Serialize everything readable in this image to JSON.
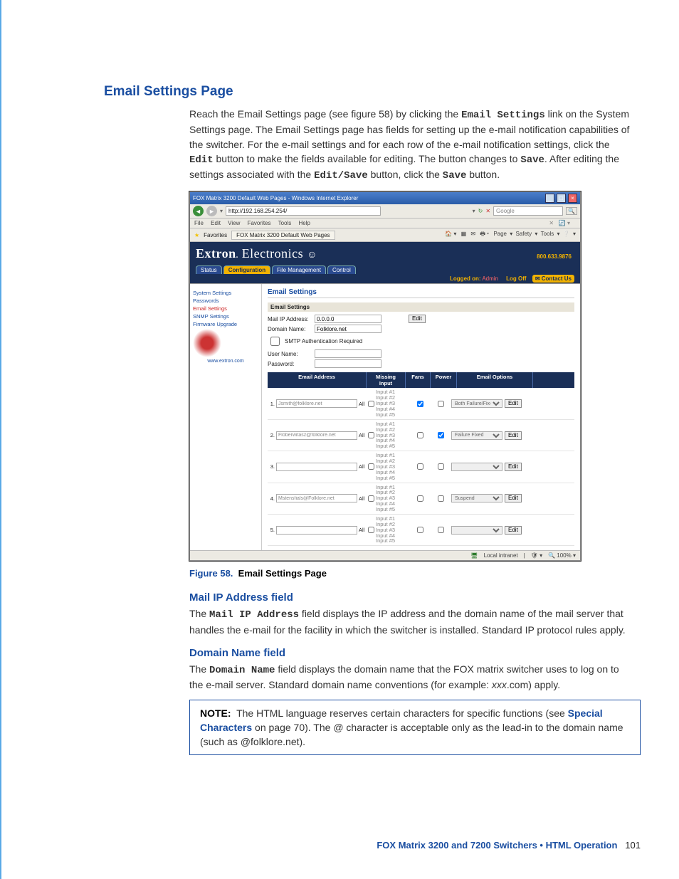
{
  "headings": {
    "page": "Email Settings Page",
    "mailip": "Mail IP Address field",
    "domain": "Domain Name field"
  },
  "intro": {
    "p1a": "Reach the Email Settings page (see figure 58) by clicking the ",
    "link": "Email Settings",
    "p1b": " link on the System Settings page. The Email Settings page has fields for setting up the e-mail notification capabilities of the switcher. For the e-mail settings and for each row of the e-mail notification settings, click the ",
    "editbtn": "Edit",
    "p1c": " button to make the fields available for editing. The button changes to ",
    "savebtn": "Save",
    "p1d": ". After editing the settings associated with the ",
    "editsave": "Edit/Save",
    "p1e": " button, click the ",
    "savebtn2": "Save",
    "p1f": " button."
  },
  "browser": {
    "title": "FOX Matrix 3200 Default Web Pages - Windows Internet Explorer",
    "url": "http://192.168.254.254/",
    "search_placeholder": "Google",
    "menu": {
      "file": "File",
      "edit": "Edit",
      "view": "View",
      "fav": "Favorites",
      "tools": "Tools",
      "help": "Help"
    },
    "fav_label": "Favorites",
    "tab": "FOX Matrix 3200 Default Web Pages",
    "toolbar": {
      "page": "Page",
      "safety": "Safety",
      "tools": "Tools"
    },
    "status": {
      "zone": "Local intranet",
      "zoom": "100%"
    }
  },
  "extron": {
    "brand": "Extron Electronics",
    "tabs": {
      "status": "Status",
      "config": "Configuration",
      "file": "File Management",
      "control": "Control"
    },
    "phone": "800.633.9876",
    "logged": "Logged on:",
    "admin": "Admin",
    "logoff": "Log Off",
    "contact": "Contact Us",
    "sidebar": {
      "sys": "System Settings",
      "pw": "Passwords",
      "email": "Email Settings",
      "snmp": "SNMP Settings",
      "fw": "Firmware Upgrade",
      "url": "www.extron.com"
    },
    "pagetitle": "Email Settings",
    "panel": "Email Settings",
    "fields": {
      "mailip_label": "Mail IP Address:",
      "mailip_val": "0.0.0.0",
      "domain_label": "Domain Name:",
      "domain_val": "Folklore.net",
      "smtp": "SMTP Authentication Required",
      "user_label": "User Name:",
      "pass_label": "Password:",
      "edit": "Edit"
    },
    "thead": {
      "email": "Email Address",
      "missing": "Missing Input",
      "fans": "Fans",
      "power": "Power",
      "opts": "Email Options"
    },
    "inputs": {
      "i1": "Input #1",
      "i2": "Input #2",
      "i3": "Input #3",
      "i4": "Input #4",
      "i5": "Input #5"
    },
    "all": "All",
    "rows": [
      {
        "n": "1.",
        "addr": "Jsmith@folklore.net",
        "fans": true,
        "power": false,
        "opt": "Both Failure/Fixed"
      },
      {
        "n": "2.",
        "addr": "Floberwitasz@folklore.net",
        "fans": false,
        "power": true,
        "opt": "Failure Fixed"
      },
      {
        "n": "3.",
        "addr": "",
        "fans": false,
        "power": false,
        "opt": ""
      },
      {
        "n": "4.",
        "addr": "Mstensfials@Folklore.net",
        "fans": false,
        "power": false,
        "opt": "Suspend"
      },
      {
        "n": "5.",
        "addr": "",
        "fans": false,
        "power": false,
        "opt": ""
      }
    ],
    "editbtn": "Edit"
  },
  "figure": {
    "pre": "Figure 58.",
    "title": "Email Settings Page"
  },
  "mailip_text": {
    "a": "The ",
    "label": "Mail IP Address",
    "b": " field displays the IP address and the domain name of the mail server that handles the e-mail for the facility in which the switcher is installed. Standard IP protocol rules apply."
  },
  "domain_text": {
    "a": "The ",
    "label": "Domain Name",
    "b": " field displays the domain name that the FOX matrix switcher uses to log on to the e-mail server. Standard domain name conventions (for example: ",
    "ex": "xxx",
    "c": ".com) apply."
  },
  "note": {
    "label": "NOTE:",
    "a": "The HTML language reserves certain characters for specific functions (see ",
    "link": "Special Characters",
    "b": " on page 70). The @ character is acceptable only as the lead-in to the domain name (such as @folklore.net)."
  },
  "footer": {
    "title": "FOX Matrix 3200 and 7200 Switchers • HTML Operation",
    "page": "101"
  }
}
